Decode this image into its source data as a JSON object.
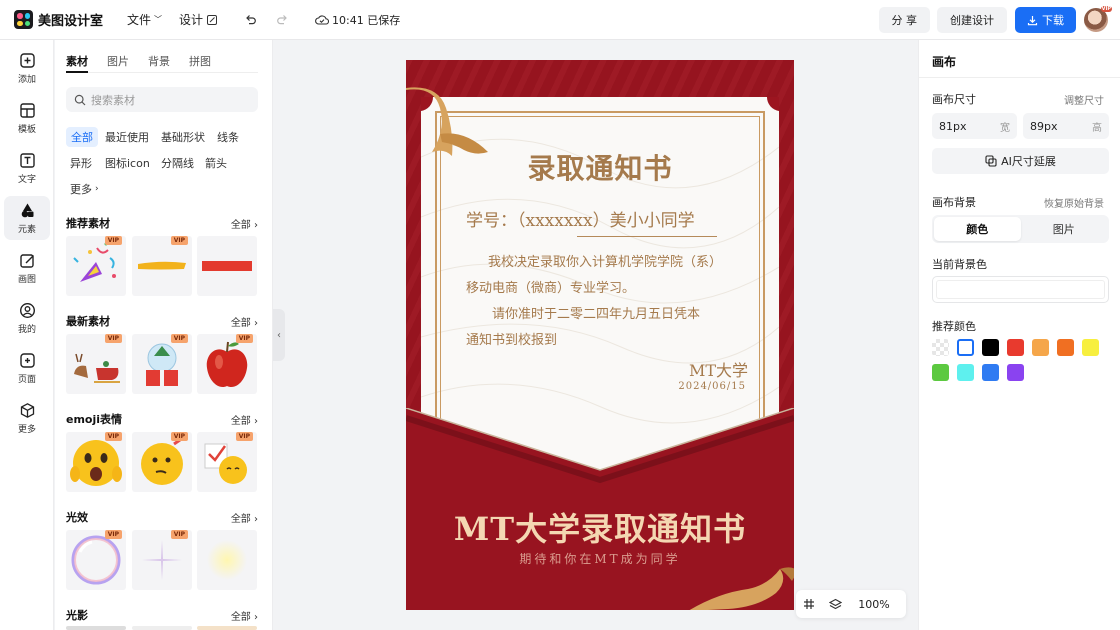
{
  "app": {
    "name": "美图设计室"
  },
  "menu": {
    "file": "文件",
    "design": "设计",
    "saved_time": "10:41 已保存"
  },
  "top_actions": {
    "share": "分 享",
    "create": "创建设计",
    "download": "下载",
    "vip_badge": "VIP"
  },
  "rail": [
    {
      "label": "添加",
      "icon": "plus-square-icon"
    },
    {
      "label": "模板",
      "icon": "template-icon"
    },
    {
      "label": "文字",
      "icon": "text-icon"
    },
    {
      "label": "元素",
      "icon": "element-shapes-icon"
    },
    {
      "label": "画图",
      "icon": "draw-icon"
    },
    {
      "label": "我的",
      "icon": "user-icon"
    },
    {
      "label": "页面",
      "icon": "page-add-icon"
    },
    {
      "label": "更多",
      "icon": "cube-icon"
    }
  ],
  "panel": {
    "tabs": [
      "素材",
      "图片",
      "背景",
      "拼图"
    ],
    "search_placeholder": "搜索素材",
    "chips": [
      "全部",
      "最近使用",
      "基础形状",
      "线条",
      "异形",
      "图标icon",
      "分隔线",
      "箭头",
      "更多"
    ],
    "sections": [
      {
        "title": "推荐素材",
        "all": "全部"
      },
      {
        "title": "最新素材",
        "all": "全部"
      },
      {
        "title": "emoji表情",
        "all": "全部"
      },
      {
        "title": "光效",
        "all": "全部"
      },
      {
        "title": "光影",
        "all": "全部"
      }
    ],
    "vip_label": "VIP"
  },
  "poster": {
    "title": "录取通知书",
    "student_line": "学号：（xxxxxxx）美小小同学",
    "body_line1": "我校决定录取你入计算机学院学院（系）",
    "body_line2": "移动电商（微商）专业学习。",
    "body_line3": "请你准时于二零二四年九月五日凭本",
    "body_line4": "通知书到校报到",
    "sign": "MT大学",
    "date": "2024/06/15",
    "big_title": "MT大学录取通知书",
    "subtitle": "期待和你在MT成为同学",
    "colors": {
      "primary": "#9c1520",
      "gold": "#a57a4c"
    }
  },
  "zoom": {
    "level": "100%"
  },
  "right": {
    "title": "画布",
    "size_label": "画布尺寸",
    "adjust_size": "调整尺寸",
    "width_value": "81px",
    "width_unit": "宽",
    "height_value": "89px",
    "height_unit": "高",
    "ai_extend": "AI尺寸延展",
    "bg_label": "画布背景",
    "restore_bg": "恢复原始背景",
    "seg_color": "颜色",
    "seg_image": "图片",
    "current_bg": "当前背景色",
    "recommended": "推荐颜色",
    "swatches": [
      "transparent",
      "#ffffff",
      "#000000",
      "#e83a2e",
      "#f5a64a",
      "#f06f22",
      "#f7ef3f",
      "#5cc940",
      "#5ef0ee",
      "#2f7bf2",
      "#8a43f0"
    ]
  }
}
